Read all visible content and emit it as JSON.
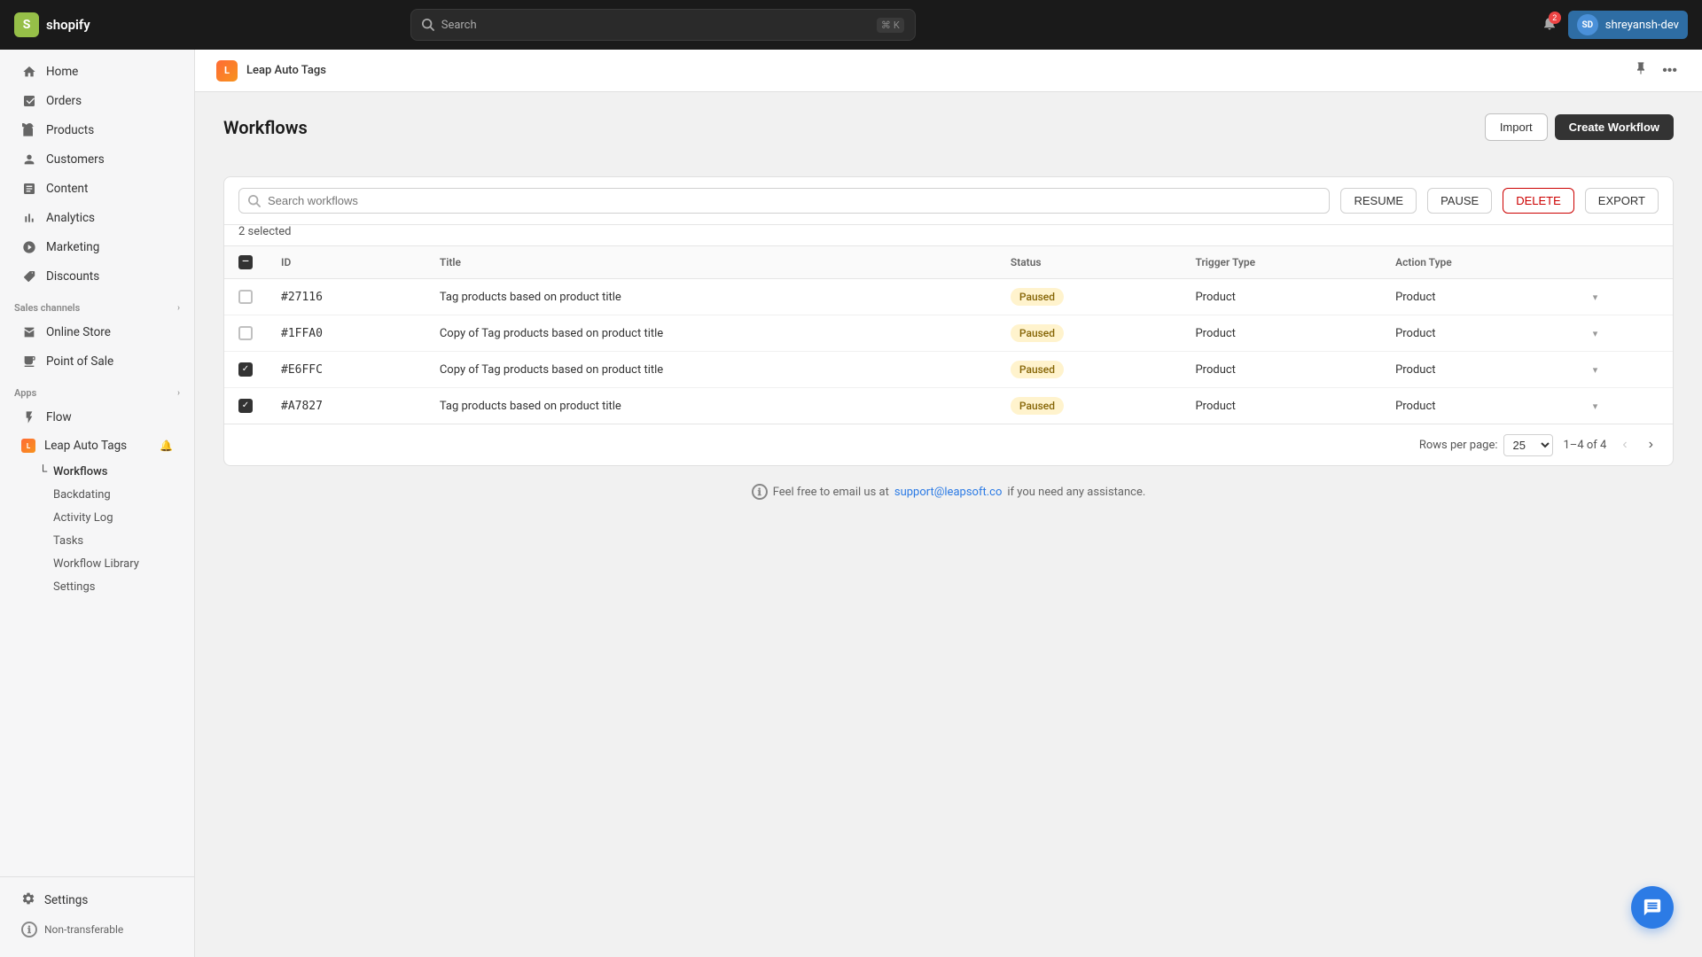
{
  "topbar": {
    "logo_text": "shopify",
    "search_placeholder": "Search",
    "search_key1": "⌘",
    "search_key2": "K",
    "notification_count": "2",
    "user_name": "shreyansh-dev",
    "user_initials": "SD"
  },
  "sidebar": {
    "nav_items": [
      {
        "id": "home",
        "label": "Home",
        "icon": "home"
      },
      {
        "id": "orders",
        "label": "Orders",
        "icon": "orders"
      },
      {
        "id": "products",
        "label": "Products",
        "icon": "products"
      },
      {
        "id": "customers",
        "label": "Customers",
        "icon": "customers"
      },
      {
        "id": "content",
        "label": "Content",
        "icon": "content"
      },
      {
        "id": "analytics",
        "label": "Analytics",
        "icon": "analytics"
      },
      {
        "id": "marketing",
        "label": "Marketing",
        "icon": "marketing"
      },
      {
        "id": "discounts",
        "label": "Discounts",
        "icon": "discounts"
      }
    ],
    "sales_channels_title": "Sales channels",
    "sales_channels": [
      {
        "id": "online-store",
        "label": "Online Store",
        "icon": "store"
      },
      {
        "id": "point-of-sale",
        "label": "Point of Sale",
        "icon": "pos"
      }
    ],
    "apps_title": "Apps",
    "apps": [
      {
        "id": "flow",
        "label": "Flow",
        "icon": "flow"
      }
    ],
    "leap_auto_tags_label": "Leap Auto Tags",
    "sub_items": [
      {
        "id": "workflows",
        "label": "Workflows",
        "active": true
      },
      {
        "id": "backdating",
        "label": "Backdating"
      },
      {
        "id": "activity-log",
        "label": "Activity Log"
      },
      {
        "id": "tasks",
        "label": "Tasks"
      },
      {
        "id": "workflow-library",
        "label": "Workflow Library"
      },
      {
        "id": "settings-sub",
        "label": "Settings"
      }
    ],
    "settings_label": "Settings",
    "non_transferable_label": "Non-transferable"
  },
  "app_header": {
    "app_name": "Leap Auto Tags",
    "app_icon_text": "L"
  },
  "page": {
    "title": "Workflows",
    "import_button": "Import",
    "create_button": "Create Workflow"
  },
  "toolbar": {
    "search_placeholder": "Search workflows",
    "resume_btn": "RESUME",
    "pause_btn": "PAUSE",
    "delete_btn": "DELETE",
    "export_btn": "EXPORT",
    "selected_info": "2 selected"
  },
  "table": {
    "headers": [
      "",
      "ID",
      "Title",
      "Status",
      "Trigger Type",
      "Action Type",
      ""
    ],
    "rows": [
      {
        "id": "#27116",
        "title": "Tag products based on product title",
        "status": "Paused",
        "trigger_type": "Product",
        "action_type": "Product",
        "checked": false
      },
      {
        "id": "#1FFA0",
        "title": "Copy of Tag products based on product title",
        "status": "Paused",
        "trigger_type": "Product",
        "action_type": "Product",
        "checked": false
      },
      {
        "id": "#E6FFC",
        "title": "Copy of Tag products based on product title",
        "status": "Paused",
        "trigger_type": "Product",
        "action_type": "Product",
        "checked": true
      },
      {
        "id": "#A7827",
        "title": "Tag products based on product title",
        "status": "Paused",
        "trigger_type": "Product",
        "action_type": "Product",
        "checked": true
      }
    ]
  },
  "pagination": {
    "rows_per_page_label": "Rows per page:",
    "rows_per_page_value": "25",
    "page_info": "1–4 of 4"
  },
  "footer": {
    "info_text_before": "Feel free to email us at",
    "email": "support@leapsoft.co",
    "info_text_after": "if you need any assistance."
  },
  "icons": {
    "home": "⌂",
    "orders": "📋",
    "products": "📦",
    "customers": "👤",
    "content": "📄",
    "analytics": "📊",
    "marketing": "📢",
    "discounts": "🏷",
    "store": "🏪",
    "pos": "🖥",
    "flow": "⚡",
    "settings": "⚙",
    "info": "i",
    "bell": "🔔",
    "search": "🔍",
    "chevron_right": "›",
    "chevron_left": "‹",
    "ellipsis": "···",
    "pin": "📌",
    "chat": "💬"
  }
}
